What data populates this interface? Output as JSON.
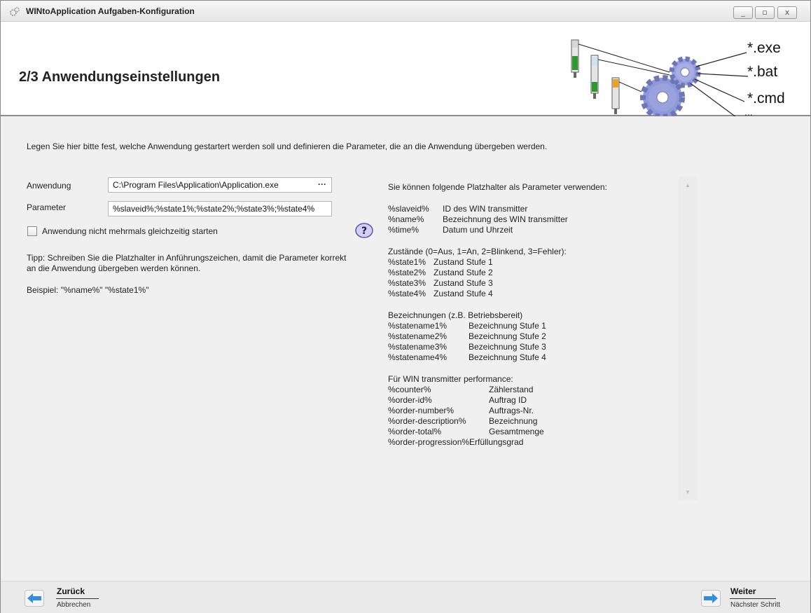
{
  "window": {
    "title": "WINtoApplication Aufgaben-Konfiguration",
    "minimize_label": "_",
    "maximize_label": "▫",
    "close_label": "x"
  },
  "header": {
    "title": "2/3 Anwendungseinstellungen",
    "graphic_labels": [
      "*.exe",
      "*.bat",
      "*.cmd",
      "..."
    ]
  },
  "intro": "Legen Sie hier bitte fest, welche Anwendung gestartert werden soll und definieren die Parameter, die an die Anwendung übergeben werden.",
  "form": {
    "application_label": "Anwendung",
    "application_value": "C:\\Program Files\\Application\\Application.exe",
    "browse_label": "···",
    "parameter_label": "Parameter",
    "parameter_value": "%slaveid%;%state1%;%state2%;%state3%;%state4%",
    "checkbox_label": "Anwendung nicht mehrmals gleichzeitig starten",
    "checkbox_checked": false,
    "tip": "Tipp: Schreiben Sie die Platzhalter in Anführungszeichen, damit die Parameter korrekt an die Anwendung übergeben werden können.",
    "example": "Beispiel: \"%name%\" \"%state1%\""
  },
  "placeholders": {
    "intro": "Sie können folgende Platzhalter als Parameter verwenden:",
    "general": [
      {
        "key": "%slaveid%",
        "desc": "ID des WIN transmitter"
      },
      {
        "key": "%name%",
        "desc": "Bezeichnung des WIN transmitter"
      },
      {
        "key": "%time%",
        "desc": "Datum und Uhrzeit"
      }
    ],
    "states_heading": "Zustände (0=Aus, 1=An, 2=Blinkend, 3=Fehler):",
    "states": [
      {
        "key": "%state1%",
        "desc": "Zustand Stufe 1"
      },
      {
        "key": "%state2%",
        "desc": "Zustand Stufe 2"
      },
      {
        "key": "%state3%",
        "desc": "Zustand Stufe 3"
      },
      {
        "key": "%state4%",
        "desc": "Zustand Stufe 4"
      }
    ],
    "names_heading": "Bezeichnungen (z.B. Betriebsbereit)",
    "names": [
      {
        "key": "%statename1%",
        "desc": "Bezeichnung Stufe 1"
      },
      {
        "key": "%statename2%",
        "desc": "Bezeichnung Stufe 2"
      },
      {
        "key": "%statename3%",
        "desc": "Bezeichnung Stufe 3"
      },
      {
        "key": "%statename4%",
        "desc": "Bezeichnung Stufe 4"
      }
    ],
    "performance_heading": "Für WIN transmitter performance:",
    "performance": [
      {
        "key": "%counter%",
        "desc": "Zählerstand"
      },
      {
        "key": "%order-id%",
        "desc": "Auftrag ID"
      },
      {
        "key": "%order-number%",
        "desc": "Auftrags-Nr."
      },
      {
        "key": "%order-description%",
        "desc": "Bezeichnung"
      },
      {
        "key": "%order-total%",
        "desc": "Gesamtmenge"
      },
      {
        "key": "%order-progression%:",
        "desc": "Erfüllungsgrad"
      }
    ]
  },
  "footer": {
    "back_title": "Zurück",
    "back_sub": "Abbrechen",
    "next_title": "Weiter",
    "next_sub": "Nächster Schritt"
  },
  "colors": {
    "nav_arrow": "#2f8ee0",
    "gear": "#8f98d8",
    "header_border": "#8c8c8c"
  }
}
